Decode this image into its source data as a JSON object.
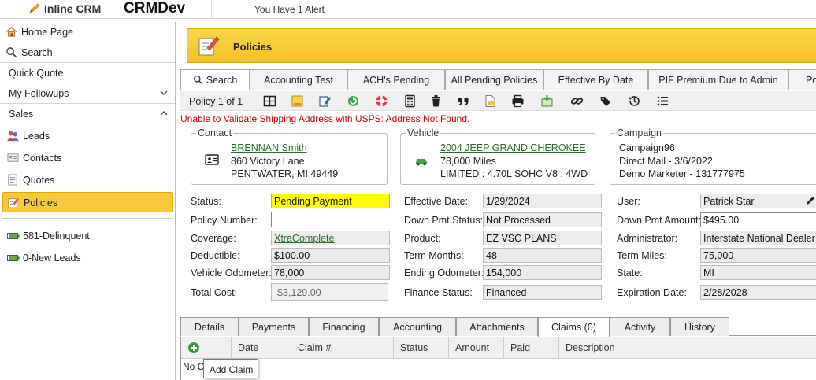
{
  "app": {
    "brand": "Inline CRM",
    "instance": "CRMDev",
    "alert": "You Have 1 Alert"
  },
  "sidebar": {
    "items": [
      {
        "label": "Home Page"
      },
      {
        "label": "Search"
      },
      {
        "label": "Quick Quote"
      },
      {
        "label": "My Followups"
      },
      {
        "label": "Sales"
      }
    ],
    "sales_items": [
      {
        "label": "Leads"
      },
      {
        "label": "Contacts"
      },
      {
        "label": "Quotes"
      },
      {
        "label": "Policies"
      }
    ],
    "saved_searches": [
      {
        "label": "581-Delinquent"
      },
      {
        "label": "0-New Leads"
      }
    ]
  },
  "page": {
    "title": "Policies"
  },
  "tabs": [
    {
      "label": "Search"
    },
    {
      "label": "Accounting Test"
    },
    {
      "label": "ACH's Pending"
    },
    {
      "label": "All Pending Policies"
    },
    {
      "label": "Effective By Date"
    },
    {
      "label": "PIF Premium Due to Admin"
    },
    {
      "label": "Po"
    }
  ],
  "toolbar": {
    "pager": "Policy 1 of 1"
  },
  "error": "Unable to Validate Shipping Address with USPS: Address Not Found.",
  "contact": {
    "legend": "Contact",
    "name": "BRENNAN Smith",
    "street": "860 Victory Lane",
    "city": "PENTWATER, MI 49449"
  },
  "vehicle": {
    "legend": "Vehicle",
    "name": "2004 JEEP GRAND CHEROKEE",
    "miles": "78,000 Miles",
    "trim": "LIMITED : 4.70L SOHC V8 : 4WD"
  },
  "campaign": {
    "legend": "Campaign",
    "name": "Campaign96",
    "source": "Direct Mail - 3/6/2022",
    "marketer": "Demo Marketer - 131777975"
  },
  "fields": {
    "status": {
      "label": "Status:",
      "value": "Pending Payment"
    },
    "policy_number": {
      "label": "Policy Number:",
      "value": ""
    },
    "coverage": {
      "label": "Coverage:",
      "value": "XtraComplete"
    },
    "deductible": {
      "label": "Deductible:",
      "value": "$100.00"
    },
    "vehicle_odometer": {
      "label": "Vehicle Odometer:",
      "value": "78,000"
    },
    "total_cost": {
      "label": "Total Cost:",
      "value": "$3,129.00"
    },
    "effective_date": {
      "label": "Effective Date:",
      "value": "1/29/2024"
    },
    "down_pmt_status": {
      "label": "Down Pmt Status:",
      "value": "Not Processed"
    },
    "product": {
      "label": "Product:",
      "value": "EZ VSC PLANS"
    },
    "term_months": {
      "label": "Term Months:",
      "value": "48"
    },
    "ending_odometer": {
      "label": "Ending Odometer:",
      "value": "154,000"
    },
    "finance_status": {
      "label": "Finance Status:",
      "value": "Financed"
    },
    "user": {
      "label": "User:",
      "value": "Patrick Star"
    },
    "down_pmt_amount": {
      "label": "Down Pmt Amount:",
      "value": "$495.00"
    },
    "administrator": {
      "label": "Administrator:",
      "value": "Interstate National Dealer S"
    },
    "term_miles": {
      "label": "Term Miles:",
      "value": "75,000"
    },
    "state": {
      "label": "State:",
      "value": "MI"
    },
    "expiration_date": {
      "label": "Expiration Date:",
      "value": "2/28/2028"
    }
  },
  "bottom_tabs": [
    {
      "label": "Details"
    },
    {
      "label": "Payments"
    },
    {
      "label": "Financing"
    },
    {
      "label": "Accounting"
    },
    {
      "label": "Attachments"
    },
    {
      "label": "Claims (0)"
    },
    {
      "label": "Activity"
    },
    {
      "label": "History"
    }
  ],
  "claims_grid": {
    "columns": [
      "Date",
      "Claim #",
      "Status",
      "Amount",
      "Paid",
      "Description"
    ],
    "empty_text": "No C",
    "tooltip": "Add Claim"
  },
  "colors": {
    "accent": "#f8c93b",
    "error": "#d00000",
    "link": "#2a6c2a",
    "status_highlight": "#ffff00"
  }
}
